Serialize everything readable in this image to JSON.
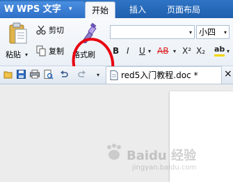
{
  "app": {
    "logo_glyph": "W",
    "name": "WPS 文字",
    "caret": "▾"
  },
  "tabs": [
    {
      "label": "开始",
      "active": true
    },
    {
      "label": "插入",
      "active": false
    },
    {
      "label": "页面布局",
      "active": false
    }
  ],
  "ribbon": {
    "paste_label": "粘贴",
    "cut_label": "剪切",
    "copy_label": "复制",
    "format_painter_label": "格式刷",
    "font_size": "小四",
    "bold": "B",
    "italic": "I",
    "underline": "U",
    "strikethrough": "AB",
    "superscript": "X²",
    "subscript": "X₂",
    "highlight": "ab"
  },
  "document": {
    "tab_title": "red5入门教程.doc *",
    "close_glyph": "×"
  },
  "watermark": {
    "text": "Baidu 经验",
    "sub": "jingyan.baidu.com"
  },
  "colors": {
    "title_bar": "#2f74c5",
    "annotation_circle": "#e8000e",
    "brush_purple": "#7b55c9"
  }
}
